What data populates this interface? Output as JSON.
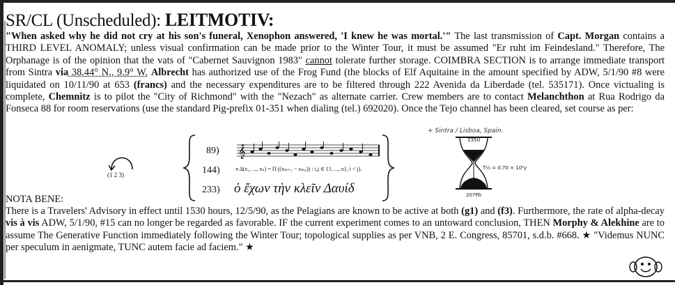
{
  "heading": {
    "prefix": "SR/CL (Unscheduled): ",
    "keyword": "LEITMOTIV:"
  },
  "body": {
    "quote": "\"When asked why he did not cry at his son's funeral, Xenophon answered, 'I knew he was mortal.'\"",
    "t1": " The last transmission of ",
    "capt_morgan": "Capt. Morgan",
    "t2": " contains a THIRD LEVEL ANOMALY; unless visual confirmation can be made prior to the Winter Tour, it must be assumed \"Er ruht im Feindesland.\" Therefore, The Orphanage is of the opinion that the vats of \"Cabernet Sauvignon 1983\" ",
    "cannot": "cannot",
    "t3": " tolerate further storage. COIMBRA SECTION is to arrange immediate transport from Sintra ",
    "via": "via",
    "coords": " 38.44° N., 9.9° W.",
    "t4": " ",
    "albrecht": "Albrecht",
    "t5": " has authorized use of the Frog Fund (the blocks of Elf Aquitaine in the amount specified by ADW, 5/1/90 #8 were liquidated on 10/11/90 at 653 ",
    "francs": "(francs)",
    "t6": " and the necessary expenditures are to be filtered through 222 Avenida da Liberdade (tel. 535171). Once victualing is complete, ",
    "chemnitz": "Chemnitz",
    "t7": " is to pilot the \"City of Richmond\" with the \"Nezach\" as alternate carrier. Crew members are to contact ",
    "melanchthon": "Melanchthon",
    "t8": " at Rua Rodrigo da Fonseca 88 for room reservations (use the standard Pig-prefix 01-351 when dialing (tel.) 692020). Once the Tejo channel has been cleared, set course as per:"
  },
  "handnote": "+ Sintra / Lisboa, Spain.",
  "cycle": {
    "label": "(1   2   3)"
  },
  "course": {
    "rows": [
      "89)",
      "144)",
      "233)"
    ],
    "formula": "π Δ(x₁, ..., xₙ) = Π ((xₘ₊₁ − xₘ₀)) : i,j ∈ {1, ..., n}, i < j).",
    "greek": "ὁ ἔχων τὴν κλεῖν Δαυίδ"
  },
  "hourglass": {
    "top_label": "235U",
    "mid_label": "T½ = 0.70 × 10⁹y",
    "bottom_label": "207Pb"
  },
  "nota_bene": {
    "label": "NOTA BENE:",
    "t1": "There is a Travelers' Advisory in effect until 1530 hours, 12/5/90, as the Pelagians are known to be active at both ",
    "g1": "(g1)",
    "t2": " and ",
    "f3": "(f3)",
    "t3": ". Furthermore, the rate of alpha-decay ",
    "visavis": "vis à vis",
    "t4": " ADW, 5/1/90, #15 can no longer be regarded as favorable. IF the current experiment comes to an untoward conclusion, THEN ",
    "morphy": "Morphy & Alekhine",
    "t5": " are to assume The Generative Function immediately following the Winter Tour; topological supplies as per VNB, 2 E. Congress, 85701, s.d.b. #668. ",
    "star": "★",
    "t6": " \"Videmus NUNC per speculum in aenigmate, TUNC autem facie ad faciem.\" "
  }
}
